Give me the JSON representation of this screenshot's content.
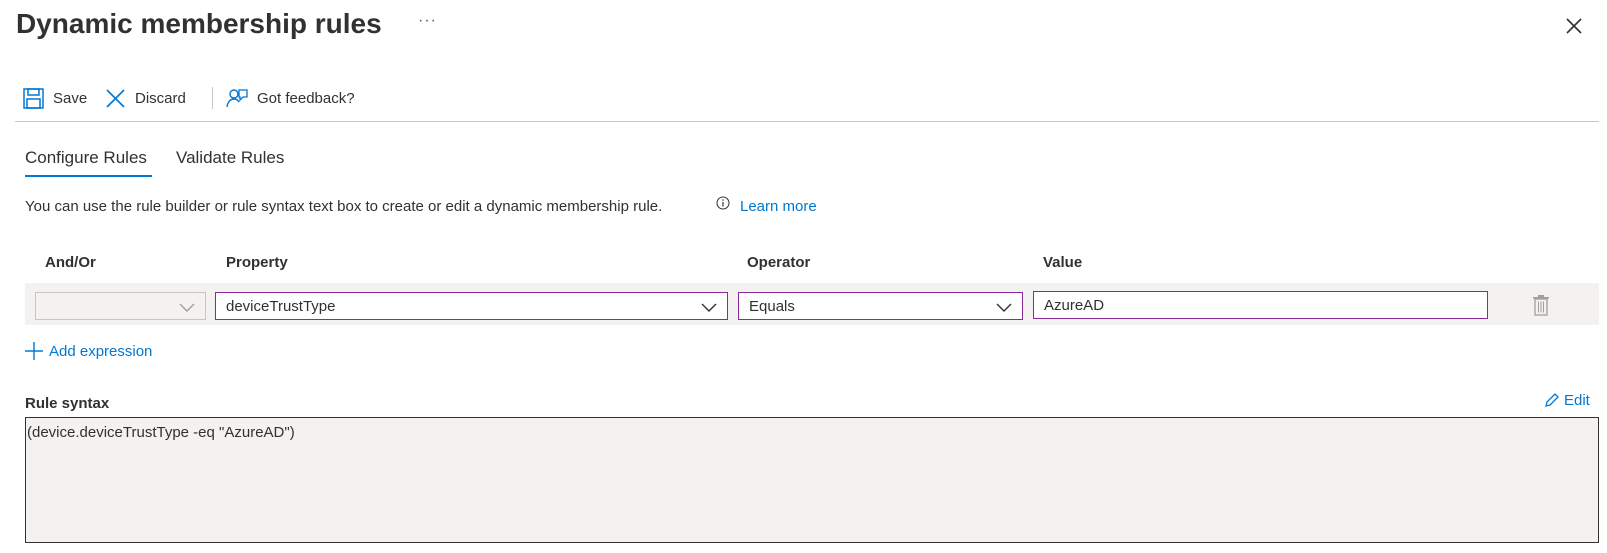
{
  "header": {
    "title": "Dynamic membership rules",
    "more_label": "···",
    "close_icon": "close-icon"
  },
  "toolbar": {
    "save_label": "Save",
    "discard_label": "Discard",
    "feedback_label": "Got feedback?"
  },
  "tabs": [
    {
      "label": "Configure Rules",
      "active": true
    },
    {
      "label": "Validate Rules",
      "active": false
    }
  ],
  "description": {
    "text": "You can use the rule builder or rule syntax text box to create or edit a dynamic membership rule.",
    "learn_more": "Learn more"
  },
  "rule_builder": {
    "columns": [
      "And/Or",
      "Property",
      "Operator",
      "Value"
    ],
    "row": {
      "and_or": "",
      "property": "deviceTrustType",
      "operator": "Equals",
      "value": "AzureAD"
    },
    "add_expression_label": "Add expression"
  },
  "rule_syntax": {
    "label": "Rule syntax",
    "edit_label": "Edit",
    "text": "(device.deviceTrustType -eq \"AzureAD\")"
  },
  "colors": {
    "accent": "#0078d4",
    "focus_border": "#8a2a9a",
    "text": "#323130"
  }
}
